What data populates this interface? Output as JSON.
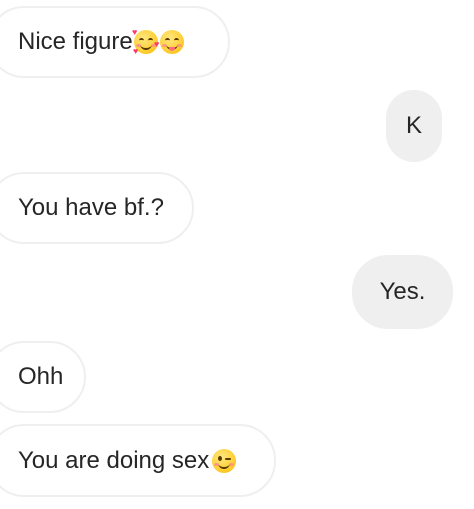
{
  "messages": [
    {
      "text": "Nice figure",
      "direction": "incoming",
      "emojis": [
        "smiling-face-with-hearts",
        "smiling-face-savoring-food"
      ]
    },
    {
      "text": "K",
      "direction": "outgoing",
      "emojis": []
    },
    {
      "text": "You have bf.?",
      "direction": "incoming",
      "emojis": []
    },
    {
      "text": "Yes.",
      "direction": "outgoing",
      "emojis": []
    },
    {
      "text": "Ohh",
      "direction": "incoming",
      "emojis": []
    },
    {
      "text": "You are doing sex",
      "direction": "incoming",
      "emojis": [
        "winking-face"
      ]
    }
  ],
  "colors": {
    "outgoing_bubble": "#efefef",
    "incoming_border": "#efefef",
    "text": "#262626",
    "background": "#ffffff"
  }
}
